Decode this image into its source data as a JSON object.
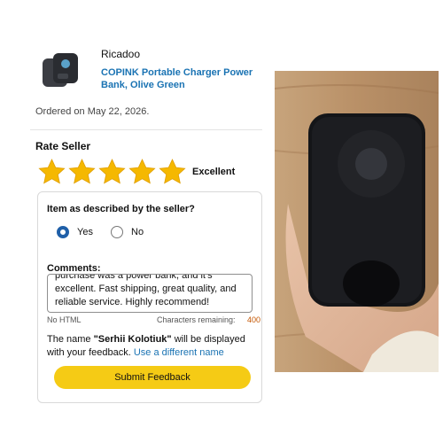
{
  "seller": {
    "name": "Ricadoo"
  },
  "product": {
    "title": "COPINK Portable Charger Power Bank, Olive Green"
  },
  "order": {
    "ordered_on": "Ordered on May 22, 2026."
  },
  "rating": {
    "title": "Rate Seller",
    "stars": 5,
    "max_stars": 5,
    "label": "Excellent",
    "star_color": "#f5b800"
  },
  "question": {
    "text": "Item as described by the seller?",
    "options": [
      {
        "label": "Yes",
        "selected": true
      },
      {
        "label": "No",
        "selected": false
      }
    ]
  },
  "comments": {
    "label": "Comments:",
    "value": "purchase was a power bank, and it's excellent. Fast shipping, great quality, and reliable service. Highly recommend!",
    "hint_left": "No HTML",
    "hint_right": "Characters remaining:",
    "remaining": "400"
  },
  "name_note": {
    "prefix": "The name ",
    "name": "\"Serhii Kolotiuk\"",
    "suffix": " will be displayed with your feedback. ",
    "link": "Use a different name"
  },
  "submit": {
    "label": "Submit Feedback",
    "color": "#f5cb15"
  },
  "colors": {
    "link": "#1a73b3",
    "radio_selected": "#1f5fa8",
    "counter": "#c45500"
  }
}
